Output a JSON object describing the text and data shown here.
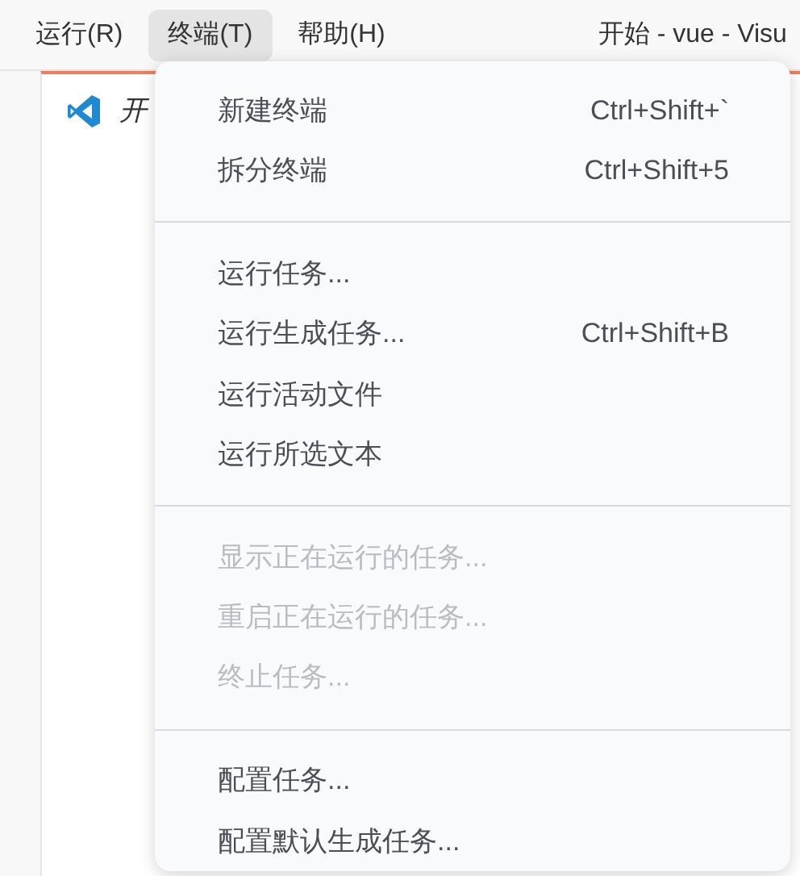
{
  "menu_bar": [
    {
      "label": "运行(R)",
      "selected": false
    },
    {
      "label": "终端(T)",
      "selected": true
    },
    {
      "label": "帮助(H)",
      "selected": false
    }
  ],
  "window": {
    "title": "开始 - vue - Visu"
  },
  "editor": {
    "tab": {
      "label": "开"
    }
  },
  "menu": {
    "groups": [
      [
        {
          "label": "新建终端",
          "shortcut": "Ctrl+Shift+`",
          "disabled": false
        },
        {
          "label": "拆分终端",
          "shortcut": "Ctrl+Shift+5",
          "disabled": false
        }
      ],
      [
        {
          "label": "运行任务...",
          "disabled": false
        },
        {
          "label": "运行生成任务...",
          "shortcut": "Ctrl+Shift+B",
          "disabled": false
        },
        {
          "label": "运行活动文件",
          "disabled": false
        },
        {
          "label": "运行所选文本",
          "disabled": false
        }
      ],
      [
        {
          "label": "显示正在运行的任务...",
          "disabled": true
        },
        {
          "label": "重启正在运行的任务...",
          "disabled": true
        },
        {
          "label": "终止任务...",
          "disabled": true
        }
      ],
      [
        {
          "label": "配置任务...",
          "disabled": false
        },
        {
          "label": "配置默认生成任务...",
          "disabled": false
        }
      ]
    ]
  }
}
